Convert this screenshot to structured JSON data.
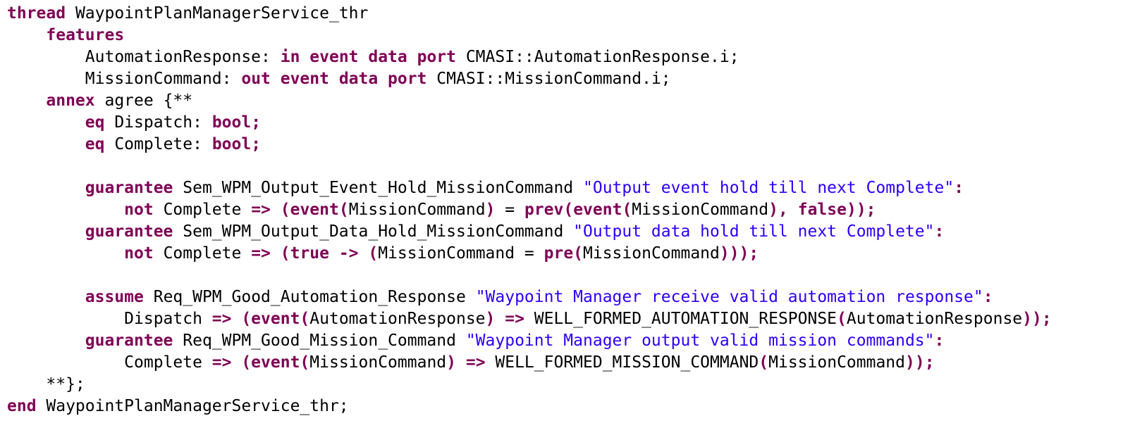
{
  "editor": {
    "colors": {
      "background": "#ffffff",
      "keyword": "#7f0055",
      "string": "#2a00ff",
      "text": "#000000"
    },
    "lines": [
      [
        {
          "t": "keyword",
          "v": "thread"
        },
        {
          "t": "plain",
          "v": " WaypointPlanManagerService_thr"
        }
      ],
      [
        {
          "t": "plain",
          "v": "    "
        },
        {
          "t": "keyword",
          "v": "features"
        }
      ],
      [
        {
          "t": "plain",
          "v": "        AutomationResponse: "
        },
        {
          "t": "keyword",
          "v": "in event data port"
        },
        {
          "t": "plain",
          "v": " CMASI::AutomationResponse.i;"
        }
      ],
      [
        {
          "t": "plain",
          "v": "        MissionCommand: "
        },
        {
          "t": "keyword",
          "v": "out event data port"
        },
        {
          "t": "plain",
          "v": " CMASI::MissionCommand.i;"
        }
      ],
      [
        {
          "t": "plain",
          "v": "    "
        },
        {
          "t": "keyword",
          "v": "annex"
        },
        {
          "t": "plain",
          "v": " agree {**"
        }
      ],
      [
        {
          "t": "plain",
          "v": "        "
        },
        {
          "t": "keyword",
          "v": "eq"
        },
        {
          "t": "plain",
          "v": " Dispatch: "
        },
        {
          "t": "keyword",
          "v": "bool;"
        }
      ],
      [
        {
          "t": "plain",
          "v": "        "
        },
        {
          "t": "keyword",
          "v": "eq"
        },
        {
          "t": "plain",
          "v": " Complete: "
        },
        {
          "t": "keyword",
          "v": "bool;"
        }
      ],
      [],
      [
        {
          "t": "plain",
          "v": "        "
        },
        {
          "t": "keyword",
          "v": "guarantee"
        },
        {
          "t": "plain",
          "v": " Sem_WPM_Output_Event_Hold_MissionCommand "
        },
        {
          "t": "string",
          "v": "\"Output event hold till next Complete\""
        },
        {
          "t": "keyword",
          "v": ":"
        }
      ],
      [
        {
          "t": "plain",
          "v": "            "
        },
        {
          "t": "keyword",
          "v": "not"
        },
        {
          "t": "plain",
          "v": " Complete "
        },
        {
          "t": "keyword",
          "v": "=> (event("
        },
        {
          "t": "plain",
          "v": "MissionCommand"
        },
        {
          "t": "keyword",
          "v": ")"
        },
        {
          "t": "plain",
          "v": " = "
        },
        {
          "t": "keyword",
          "v": "prev(event("
        },
        {
          "t": "plain",
          "v": "MissionCommand"
        },
        {
          "t": "keyword",
          "v": "),"
        },
        {
          "t": "plain",
          "v": " "
        },
        {
          "t": "keyword",
          "v": "false));"
        }
      ],
      [
        {
          "t": "plain",
          "v": "        "
        },
        {
          "t": "keyword",
          "v": "guarantee"
        },
        {
          "t": "plain",
          "v": " Sem_WPM_Output_Data_Hold_MissionCommand "
        },
        {
          "t": "string",
          "v": "\"Output data hold till next Complete\""
        },
        {
          "t": "keyword",
          "v": ":"
        }
      ],
      [
        {
          "t": "plain",
          "v": "            "
        },
        {
          "t": "keyword",
          "v": "not"
        },
        {
          "t": "plain",
          "v": " Complete "
        },
        {
          "t": "keyword",
          "v": "=> (true -> ("
        },
        {
          "t": "plain",
          "v": "MissionCommand = "
        },
        {
          "t": "keyword",
          "v": "pre("
        },
        {
          "t": "plain",
          "v": "MissionCommand"
        },
        {
          "t": "keyword",
          "v": ")));"
        }
      ],
      [],
      [
        {
          "t": "plain",
          "v": "        "
        },
        {
          "t": "keyword",
          "v": "assume"
        },
        {
          "t": "plain",
          "v": " Req_WPM_Good_Automation_Response "
        },
        {
          "t": "string",
          "v": "\"Waypoint Manager receive valid automation response\""
        },
        {
          "t": "keyword",
          "v": ":"
        }
      ],
      [
        {
          "t": "plain",
          "v": "            Dispatch "
        },
        {
          "t": "keyword",
          "v": "=> (event("
        },
        {
          "t": "plain",
          "v": "AutomationResponse"
        },
        {
          "t": "keyword",
          "v": ") =>"
        },
        {
          "t": "plain",
          "v": " WELL_FORMED_AUTOMATION_RESPONSE"
        },
        {
          "t": "keyword",
          "v": "("
        },
        {
          "t": "plain",
          "v": "AutomationResponse"
        },
        {
          "t": "keyword",
          "v": "));"
        }
      ],
      [
        {
          "t": "plain",
          "v": "        "
        },
        {
          "t": "keyword",
          "v": "guarantee"
        },
        {
          "t": "plain",
          "v": " Req_WPM_Good_Mission_Command "
        },
        {
          "t": "string",
          "v": "\"Waypoint Manager output valid mission commands\""
        },
        {
          "t": "keyword",
          "v": ":"
        }
      ],
      [
        {
          "t": "plain",
          "v": "            Complete "
        },
        {
          "t": "keyword",
          "v": "=> (event("
        },
        {
          "t": "plain",
          "v": "MissionCommand"
        },
        {
          "t": "keyword",
          "v": ") =>"
        },
        {
          "t": "plain",
          "v": " WELL_FORMED_MISSION_COMMAND"
        },
        {
          "t": "keyword",
          "v": "("
        },
        {
          "t": "plain",
          "v": "MissionCommand"
        },
        {
          "t": "keyword",
          "v": "));"
        }
      ],
      [
        {
          "t": "plain",
          "v": "    **};"
        }
      ],
      [
        {
          "t": "keyword",
          "v": "end"
        },
        {
          "t": "plain",
          "v": " WaypointPlanManagerService_thr;"
        }
      ]
    ]
  }
}
